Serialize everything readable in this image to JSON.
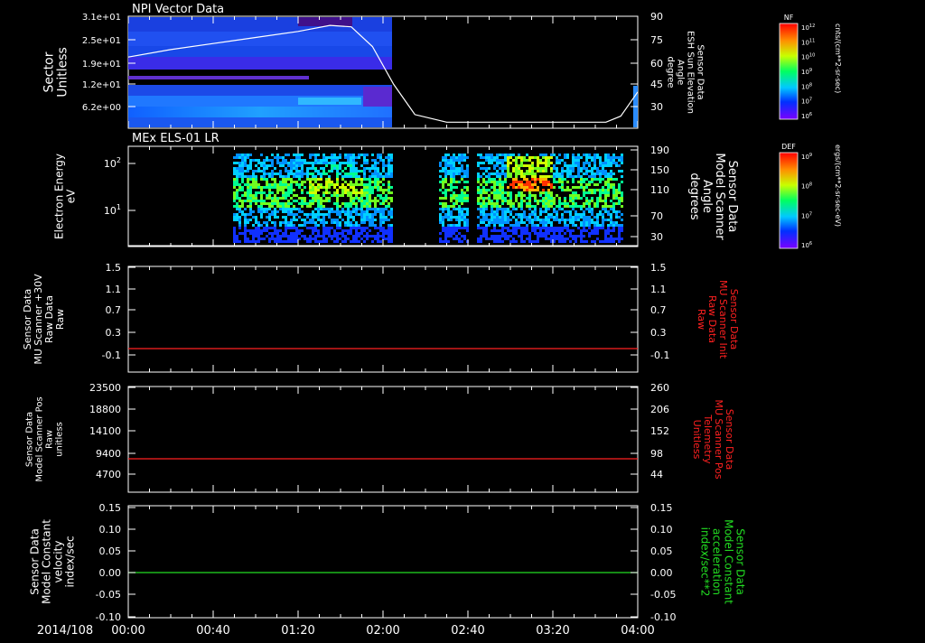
{
  "date_label": "2014/108",
  "x_ticks": [
    "00:00",
    "00:40",
    "01:20",
    "02:00",
    "02:40",
    "03:20",
    "04:00"
  ],
  "colors": {
    "white": "#ffffff",
    "red": "#ff2020",
    "green": "#22dd22"
  },
  "panels": [
    {
      "id": "npi",
      "title": "NPI Vector Data",
      "left_label": [
        "Sector",
        "Unitless"
      ],
      "left_ticks": [
        "3.1e+01",
        "2.5e+01",
        "1.9e+01",
        "1.2e+01",
        "6.2e+00"
      ],
      "right_label": [
        "Sensor Data",
        "ESH Sun Elevation",
        "Angle",
        "degree"
      ],
      "right_ticks": [
        "90",
        "75",
        "60",
        "45",
        "30"
      ],
      "colorbar_title": "NF",
      "colorbar_ticks": [
        "10^12",
        "10^11",
        "10^10",
        "10^9",
        "10^8",
        "10^7",
        "10^6"
      ],
      "colorbar_label": "cnts/(cm**2-sr-sec)"
    },
    {
      "id": "els",
      "title": "MEx ELS-01 LR",
      "left_label": [
        "Electron Energy",
        "eV"
      ],
      "left_ticks": [
        "10^2",
        "10^1"
      ],
      "right_label": [
        "Sensor Data",
        "Model Scanner",
        "Angle",
        "degrees"
      ],
      "right_ticks": [
        "190",
        "150",
        "110",
        "70",
        "30"
      ],
      "colorbar_title": "DEF",
      "colorbar_ticks": [
        "10^9",
        "10^8",
        "10^7",
        "10^6"
      ],
      "colorbar_label": "ergs/(cm**2-sr-sec-eV)"
    },
    {
      "id": "mu30",
      "left_label": [
        "Sensor Data",
        "MU Scanner +30V",
        "Raw Data",
        "Raw"
      ],
      "left_ticks": [
        "1.5",
        "1.1",
        "0.7",
        "0.3",
        "-0.1"
      ],
      "right_label": [
        "Sensor Data",
        "MU Scanner Init",
        "Raw Data",
        "Raw"
      ],
      "right_ticks": [
        "1.5",
        "1.1",
        "0.7",
        "0.3",
        "-0.1"
      ]
    },
    {
      "id": "mupos",
      "left_label": [
        "Sensor Data",
        "Model Scanner Pos",
        "Raw",
        "unitless"
      ],
      "left_ticks": [
        "23500",
        "18800",
        "14100",
        "9400",
        "4700"
      ],
      "right_label": [
        "Sensor Data",
        "MU Scanner Pos",
        "Telemetry",
        "Unitless"
      ],
      "right_ticks": [
        "260",
        "206",
        "152",
        "98",
        "44"
      ]
    },
    {
      "id": "velocity",
      "left_label": [
        "Sensor Data",
        "Model Constant",
        "velocity",
        "index/sec"
      ],
      "left_ticks": [
        "0.15",
        "0.10",
        "0.05",
        "0.00",
        "-0.05",
        "-0.10"
      ],
      "right_label": [
        "Sensor Data",
        "Model Constant",
        "acceleration",
        "index/sec**2"
      ],
      "right_ticks": [
        "0.15",
        "0.10",
        "0.05",
        "0.00",
        "-0.05",
        "-0.10"
      ]
    }
  ],
  "chart_data": [
    {
      "type": "heatmap",
      "title": "NPI Vector Data",
      "x_range": [
        "00:00",
        "04:00"
      ],
      "data_coverage": [
        "00:00",
        "02:05"
      ],
      "y_label": "Sector Unitless",
      "line_series": {
        "label": "ESH Sun Elevation Angle (degree)",
        "x_minutes": [
          0,
          20,
          40,
          60,
          80,
          95,
          105,
          115,
          125,
          135,
          150,
          180,
          210,
          225,
          232,
          240
        ],
        "values": [
          63,
          68,
          72,
          76,
          80,
          84,
          83,
          70,
          45,
          25,
          20,
          20,
          20,
          20,
          24,
          40
        ]
      }
    },
    {
      "type": "heatmap",
      "title": "MEx ELS-01 LR",
      "x_range": [
        "00:00",
        "04:00"
      ],
      "data_coverage": [
        [
          "00:50",
          "02:05"
        ],
        [
          "02:10",
          "02:20"
        ],
        [
          "02:40",
          "03:55"
        ]
      ],
      "y_label": "Electron Energy eV",
      "y_scale": "log",
      "line_series": {
        "label": "Model Scanner Angle (degrees)",
        "value": 0
      }
    },
    {
      "type": "line",
      "x_range": [
        "00:00",
        "04:00"
      ],
      "ylim": [
        -0.3,
        1.5
      ],
      "series": [
        {
          "name": "MU Scanner +30V Raw Data",
          "color": "#ff2020",
          "x_minutes": [
            0,
            240
          ],
          "values": [
            -0.1,
            -0.1
          ]
        }
      ]
    },
    {
      "type": "line",
      "x_range": [
        "00:00",
        "04:00"
      ],
      "ylim": [
        0,
        23500
      ],
      "series": [
        {
          "name": "Model Scanner Pos Raw",
          "color": "#ff2020",
          "x_minutes": [
            0,
            240
          ],
          "values": [
            7100,
            7100
          ]
        }
      ]
    },
    {
      "type": "line",
      "x_range": [
        "00:00",
        "04:00"
      ],
      "ylim": [
        -0.1,
        0.15
      ],
      "series": [
        {
          "name": "Model Constant velocity",
          "color": "#22dd22",
          "x_minutes": [
            0,
            240
          ],
          "values": [
            0.0,
            0.0
          ]
        }
      ]
    }
  ]
}
